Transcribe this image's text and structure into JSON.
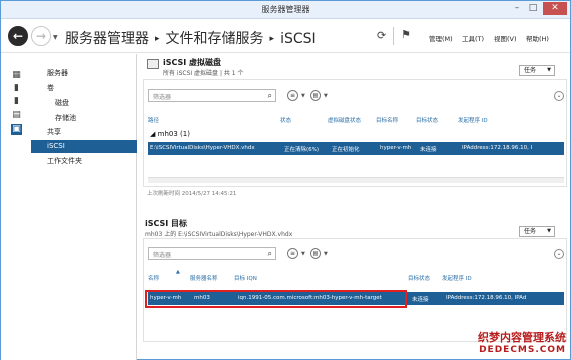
{
  "window": {
    "title": "服务器管理器"
  },
  "nav": {
    "crumbs": [
      "服务器管理器",
      "文件和存储服务",
      "iSCSI"
    ],
    "menu": [
      "管理(M)",
      "工具(T)",
      "视图(V)",
      "帮助(H)"
    ]
  },
  "sidebar": {
    "items": [
      {
        "label": "服务器",
        "sub": false,
        "selected": false
      },
      {
        "label": "卷",
        "sub": false,
        "selected": false
      },
      {
        "label": "磁盘",
        "sub": true,
        "selected": false
      },
      {
        "label": "存储池",
        "sub": true,
        "selected": false
      },
      {
        "label": "共享",
        "sub": false,
        "selected": false
      },
      {
        "label": "iSCSI",
        "sub": false,
        "selected": true
      },
      {
        "label": "工作文件夹",
        "sub": false,
        "selected": false
      }
    ]
  },
  "vdisks": {
    "title": "iSCSI 虚拟磁盘",
    "subtitle": "所有 iSCSI 虚拟磁盘 | 共 1 个",
    "tasks": "任务",
    "filter_placeholder": "筛选器",
    "columns": [
      "路径",
      "状态",
      "虚拟磁盘状态",
      "目标名称",
      "目标状态",
      "发起程序 ID"
    ],
    "group": "mh03 (1)",
    "row": [
      "E:\\iSCSIVirtualDisks\\Hyper-VHDX.vhdx",
      "正在清除(6%)",
      "正在初始化",
      "hyper-v-mh",
      "未连接",
      "IPAddress:172.18.96.10, I"
    ],
    "last_refresh": "上次刷新时间 2014/5/27 14:45:21"
  },
  "targets": {
    "title": "iSCSI 目标",
    "subtitle": "mh03 上的 E:\\iSCSIVirtualDisks\\Hyper-VHDX.vhdx",
    "tasks": "任务",
    "filter_placeholder": "筛选器",
    "columns": [
      "名称",
      "服务器名称",
      "目标 IQN",
      "目标状态",
      "发起程序 ID"
    ],
    "row": [
      "hyper-v-mh",
      "mh03",
      "iqn.1991-05.com.microsoft:mh03-hyper-v-mh-target",
      "未连接",
      "IPAddress:172.18.96.10, IPAd"
    ]
  },
  "watermark": {
    "line1": "织梦内容管理系统",
    "line2": "DEDECMS.COM"
  },
  "colors": {
    "accent": "#1e5f96",
    "highlight": "#e02020"
  }
}
